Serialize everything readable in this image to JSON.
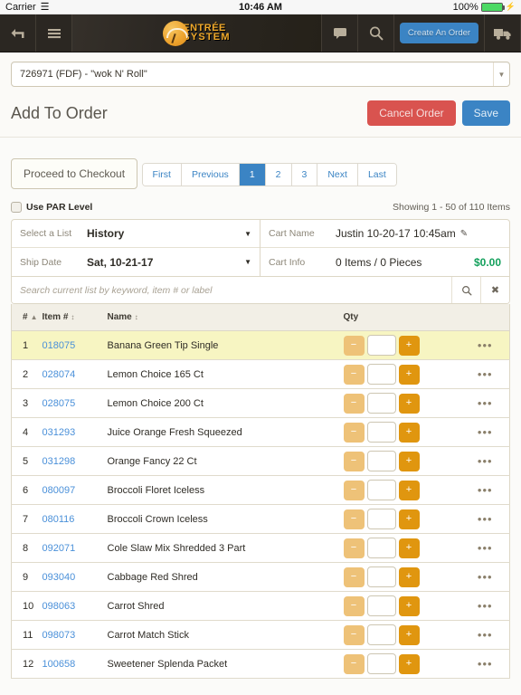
{
  "status_bar": {
    "carrier": "Carrier",
    "wifi_icon": "wifi-icon",
    "time": "10:46 AM",
    "battery_percent": "100%",
    "battery_icon": "battery-full-icon",
    "charging_icon": "lightning-bolt-icon"
  },
  "navbar": {
    "back_icon": "back-arrow-icon",
    "menu_icon": "hamburger-menu-icon",
    "logo_line1": "ENTRÉE",
    "logo_line2": "SYSTEM",
    "chat_icon": "chat-bubble-icon",
    "search_icon": "search-icon",
    "create_order_label": "Create An Order",
    "truck_icon": "delivery-truck-icon",
    "create_order_color": "#3b84c4",
    "bar_color": "#2b2722"
  },
  "customer": {
    "value": "726971 (FDF) - \"wok N' Roll\"",
    "caret_icon": "chevron-down-icon"
  },
  "header": {
    "title": "Add To Order",
    "cancel_label": "Cancel Order",
    "save_label": "Save",
    "cancel_color": "#d9534f",
    "save_color": "#3b84c4"
  },
  "toolbar": {
    "checkout_label": "Proceed to Checkout"
  },
  "pagination": {
    "items": [
      {
        "label": "First",
        "active": false
      },
      {
        "label": "Previous",
        "active": false
      },
      {
        "label": "1",
        "active": true
      },
      {
        "label": "2",
        "active": false
      },
      {
        "label": "3",
        "active": false
      },
      {
        "label": "Next",
        "active": false
      },
      {
        "label": "Last",
        "active": false
      }
    ],
    "active_color": "#3b84c4"
  },
  "par": {
    "label": "Use PAR Level",
    "checked": false
  },
  "showing": "Showing 1 - 50 of 110 Items",
  "panel": {
    "select_list_label": "Select a List",
    "select_list_value": "History",
    "ship_date_label": "Ship Date",
    "ship_date_value": "Sat, 10-21-17",
    "cart_name_label": "Cart Name",
    "cart_name_value": "Justin 10-20-17 10:45am",
    "cart_name_edit_icon": "pencil-edit-icon",
    "cart_info_label": "Cart Info",
    "cart_info_value": "0 Items / 0 Pieces",
    "cart_total": "$0.00",
    "cart_total_color": "#13a05c"
  },
  "search": {
    "placeholder": "Search current list by keyword, item # or label",
    "value": "",
    "search_icon": "search-icon",
    "clear_icon": "clear-x-icon"
  },
  "table": {
    "columns": [
      {
        "label": "#",
        "sort": "asc"
      },
      {
        "label": "Item #",
        "sort": "none"
      },
      {
        "label": "Name",
        "sort": "none"
      },
      {
        "label": "Qty",
        "sort": null
      },
      {
        "label": "",
        "sort": null
      }
    ],
    "minus_label": "−",
    "plus_label": "+",
    "more_icon": "ellipsis-more-icon",
    "rows": [
      {
        "num": "1",
        "item": "018075",
        "name": "Banana Green Tip Single",
        "qty": "",
        "highlight": true
      },
      {
        "num": "2",
        "item": "028074",
        "name": "Lemon Choice 165 Ct",
        "qty": "",
        "highlight": false
      },
      {
        "num": "3",
        "item": "028075",
        "name": "Lemon Choice 200 Ct",
        "qty": "",
        "highlight": false
      },
      {
        "num": "4",
        "item": "031293",
        "name": "Juice Orange Fresh Squeezed",
        "qty": "",
        "highlight": false
      },
      {
        "num": "5",
        "item": "031298",
        "name": "Orange Fancy 22 Ct",
        "qty": "",
        "highlight": false
      },
      {
        "num": "6",
        "item": "080097",
        "name": "Broccoli Floret Iceless",
        "qty": "",
        "highlight": false
      },
      {
        "num": "7",
        "item": "080116",
        "name": "Broccoli Crown Iceless",
        "qty": "",
        "highlight": false
      },
      {
        "num": "8",
        "item": "092071",
        "name": "Cole Slaw Mix Shredded 3 Part",
        "qty": "",
        "highlight": false
      },
      {
        "num": "9",
        "item": "093040",
        "name": "Cabbage Red Shred",
        "qty": "",
        "highlight": false
      },
      {
        "num": "10",
        "item": "098063",
        "name": "Carrot Shred",
        "qty": "",
        "highlight": false
      },
      {
        "num": "11",
        "item": "098073",
        "name": "Carrot Match Stick",
        "qty": "",
        "highlight": false
      },
      {
        "num": "12",
        "item": "100658",
        "name": "Sweetener Splenda Packet",
        "qty": "",
        "highlight": false
      }
    ]
  }
}
